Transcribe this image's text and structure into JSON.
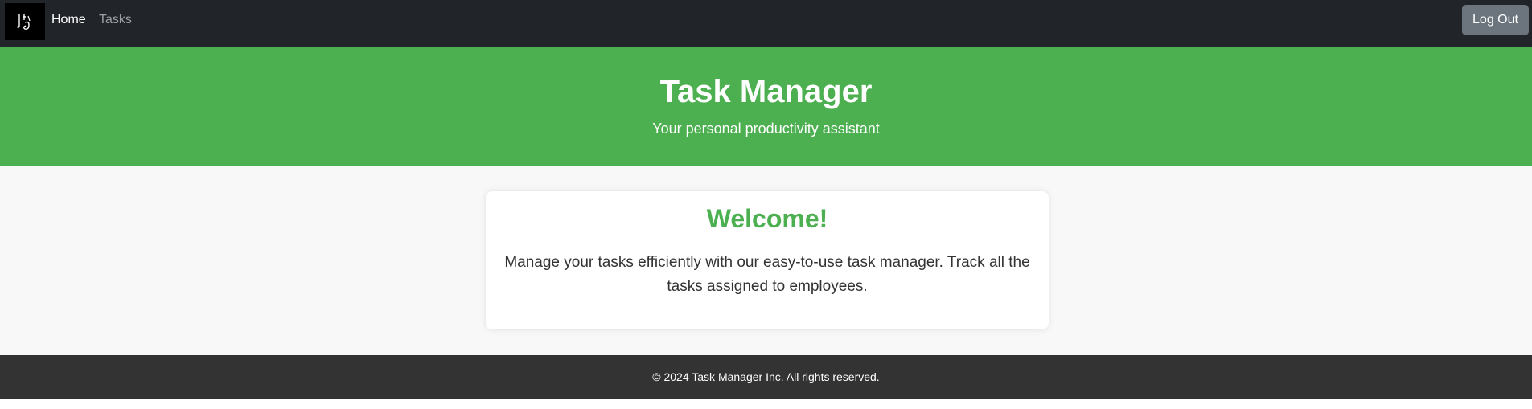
{
  "navbar": {
    "logo_icon": "handwritten-letters-logo",
    "links": [
      {
        "label": "Home"
      },
      {
        "label": "Tasks"
      }
    ],
    "logout_label": "Log Out"
  },
  "hero": {
    "title": "Task Manager",
    "subtitle": "Your personal productivity assistant"
  },
  "card": {
    "title": "Welcome!",
    "text": "Manage your tasks efficiently with our easy-to-use task manager. Track all the tasks assigned to employees."
  },
  "footer": {
    "text": "© 2024 Task Manager Inc. All rights reserved."
  },
  "colors": {
    "navbar_bg": "#212529",
    "accent_green": "#4caf50",
    "button_gray": "#6c757d",
    "footer_bg": "#333333"
  }
}
